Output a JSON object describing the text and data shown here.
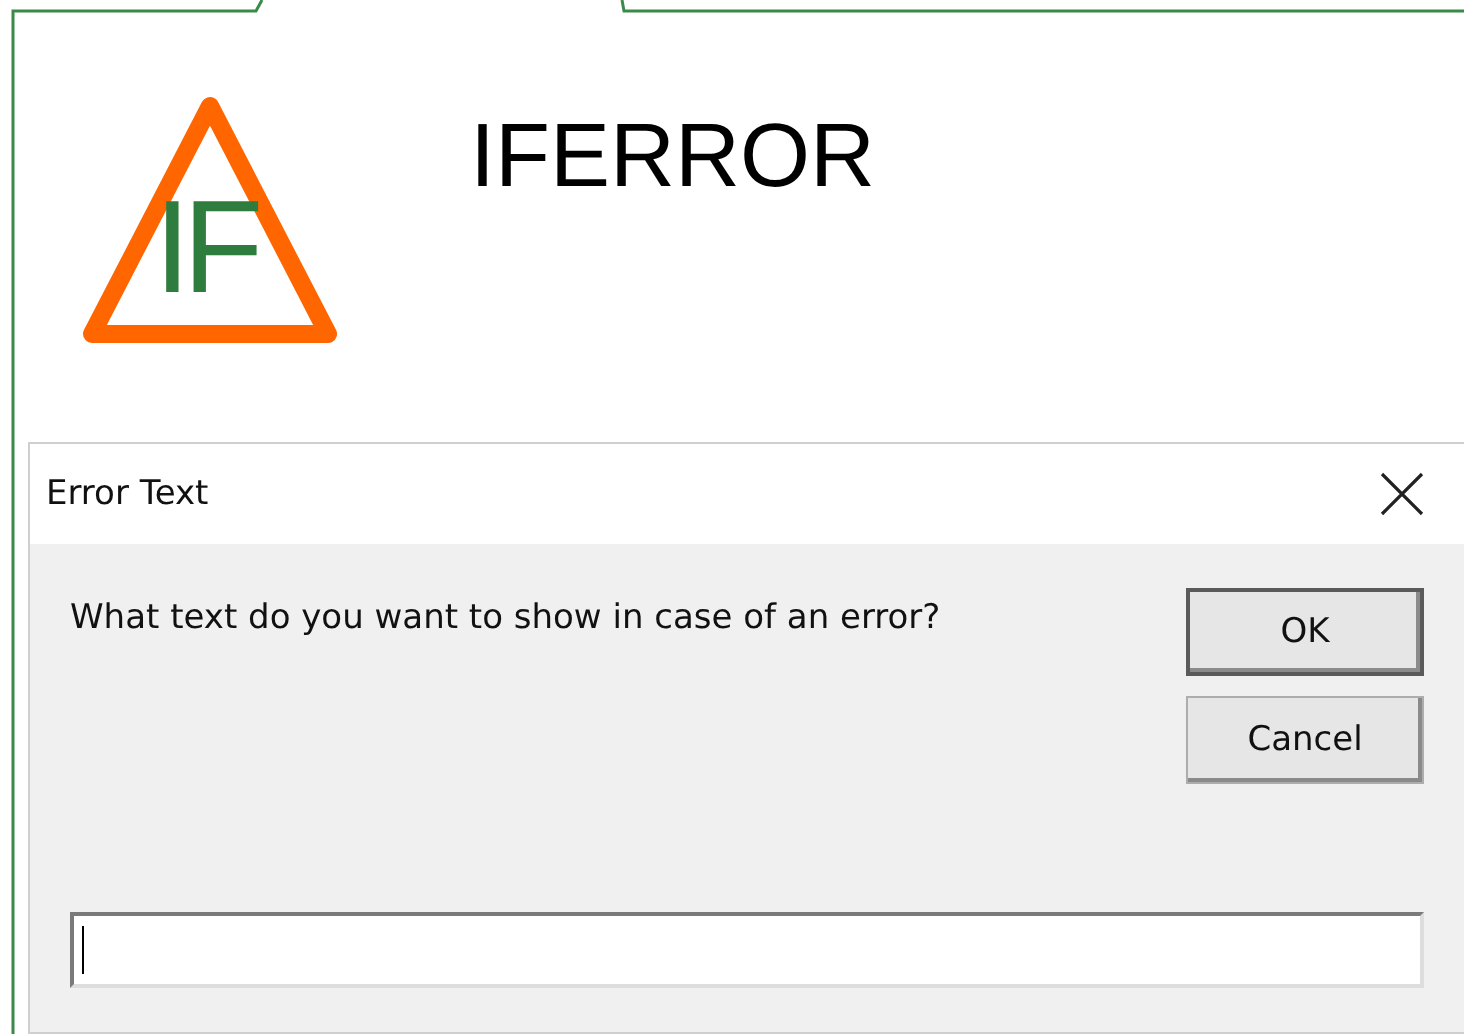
{
  "logo": {
    "text": "IF"
  },
  "title": "IFERROR",
  "dialog": {
    "title": "Error Text",
    "prompt": "What text do you want to show in case of an error?",
    "buttons": [
      {
        "label": "OK",
        "default": true
      },
      {
        "label": "Cancel",
        "default": false
      }
    ],
    "input": {
      "focused": true
    }
  }
}
